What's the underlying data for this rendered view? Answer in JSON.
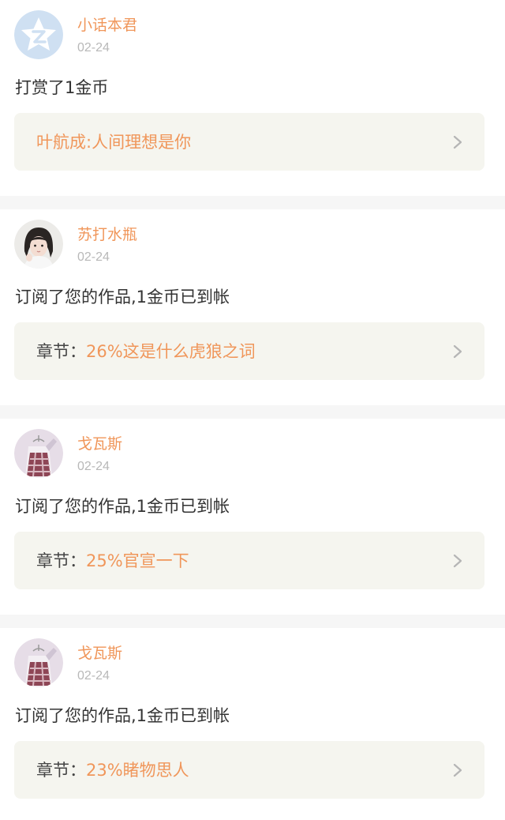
{
  "notifications": [
    {
      "avatar": "qq-zone-default-avatar",
      "username": "小话本君",
      "date": "02-24",
      "action": "打赏了1金币",
      "link_prefix": "",
      "link_title": "叶航成:人间理想是你"
    },
    {
      "avatar": "girl-photo-avatar",
      "username": "苏打水瓶",
      "date": "02-24",
      "action": "订阅了您的作品,1金币已到帐",
      "link_prefix": "章节：",
      "link_title": "26%这是什么虎狼之词"
    },
    {
      "avatar": "plaid-clothes-avatar",
      "username": "戈瓦斯",
      "date": "02-24",
      "action": "订阅了您的作品,1金币已到帐",
      "link_prefix": "章节：",
      "link_title": "25%官宣一下"
    },
    {
      "avatar": "plaid-clothes-avatar",
      "username": "戈瓦斯",
      "date": "02-24",
      "action": "订阅了您的作品,1金币已到帐",
      "link_prefix": "章节：",
      "link_title": "23%睹物思人"
    }
  ],
  "colors": {
    "accent": "#f0965a",
    "date": "#b8b8b8",
    "text": "#333333",
    "link_bg": "#f5f5ef",
    "page_bg": "#f6f6f6"
  }
}
